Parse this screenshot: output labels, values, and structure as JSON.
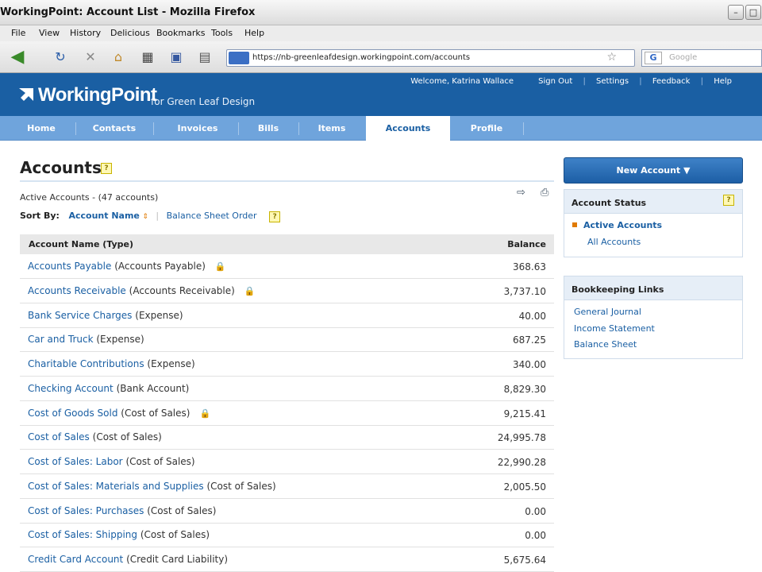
{
  "browser": {
    "window_title": "WorkingPoint: Account List - Mozilla Firefox",
    "menu": [
      "File",
      "View",
      "History",
      "Delicious",
      "Bookmarks",
      "Tools",
      "Help"
    ],
    "url": "https://nb-greenleafdesign.workingpoint.com/accounts",
    "search_placeholder": "Google",
    "search_engine": "G"
  },
  "app": {
    "logo": "WorkingPoint",
    "for_company": "for Green Leaf Design",
    "welcome": "Welcome, Katrina Wallace",
    "links": [
      "Sign Out",
      "Settings",
      "Feedback",
      "Help"
    ]
  },
  "tabs": [
    {
      "label": "Home"
    },
    {
      "label": "Contacts"
    },
    {
      "label": "Invoices"
    },
    {
      "label": "Bills"
    },
    {
      "label": "Items"
    },
    {
      "label": "Accounts"
    },
    {
      "label": "Profile"
    }
  ],
  "page": {
    "title": "Accounts",
    "help": "?",
    "active_count": "Active Accounts - (47 accounts)",
    "sort_label": "Sort By:",
    "sort_current": "Account Name",
    "sort_arrow": "⇕",
    "sort_alt": "Balance Sheet Order",
    "col_name": "Account Name (Type)",
    "col_balance": "Balance"
  },
  "accounts": [
    {
      "name": "Accounts Payable",
      "type": "(Accounts Payable)",
      "locked": true,
      "balance": "368.63"
    },
    {
      "name": "Accounts Receivable",
      "type": "(Accounts Receivable)",
      "locked": true,
      "balance": "3,737.10"
    },
    {
      "name": "Bank Service Charges",
      "type": "(Expense)",
      "locked": false,
      "balance": "40.00"
    },
    {
      "name": "Car and Truck",
      "type": "(Expense)",
      "locked": false,
      "balance": "687.25"
    },
    {
      "name": "Charitable Contributions",
      "type": "(Expense)",
      "locked": false,
      "balance": "340.00"
    },
    {
      "name": "Checking Account",
      "type": "(Bank Account)",
      "locked": false,
      "balance": "8,829.30"
    },
    {
      "name": "Cost of Goods Sold",
      "type": "(Cost of Sales)",
      "locked": true,
      "balance": "9,215.41"
    },
    {
      "name": "Cost of Sales",
      "type": "(Cost of Sales)",
      "locked": false,
      "balance": "24,995.78"
    },
    {
      "name": "Cost of Sales: Labor",
      "type": "(Cost of Sales)",
      "locked": false,
      "balance": "22,990.28"
    },
    {
      "name": "Cost of Sales: Materials and Supplies",
      "type": "(Cost of Sales)",
      "locked": false,
      "balance": "2,005.50"
    },
    {
      "name": "Cost of Sales: Purchases",
      "type": "(Cost of Sales)",
      "locked": false,
      "balance": "0.00"
    },
    {
      "name": "Cost of Sales: Shipping",
      "type": "(Cost of Sales)",
      "locked": false,
      "balance": "0.00"
    },
    {
      "name": "Credit Card Account",
      "type": "(Credit Card Liability)",
      "locked": false,
      "balance": "5,675.64"
    }
  ],
  "sidebar": {
    "new_account": "New Account ▼",
    "status_title": "Account Status",
    "status_items": [
      "Active Accounts",
      "All Accounts"
    ],
    "bookkeeping_title": "Bookkeeping Links",
    "bookkeeping_items": [
      "General Journal",
      "Income Statement",
      "Balance Sheet"
    ]
  }
}
